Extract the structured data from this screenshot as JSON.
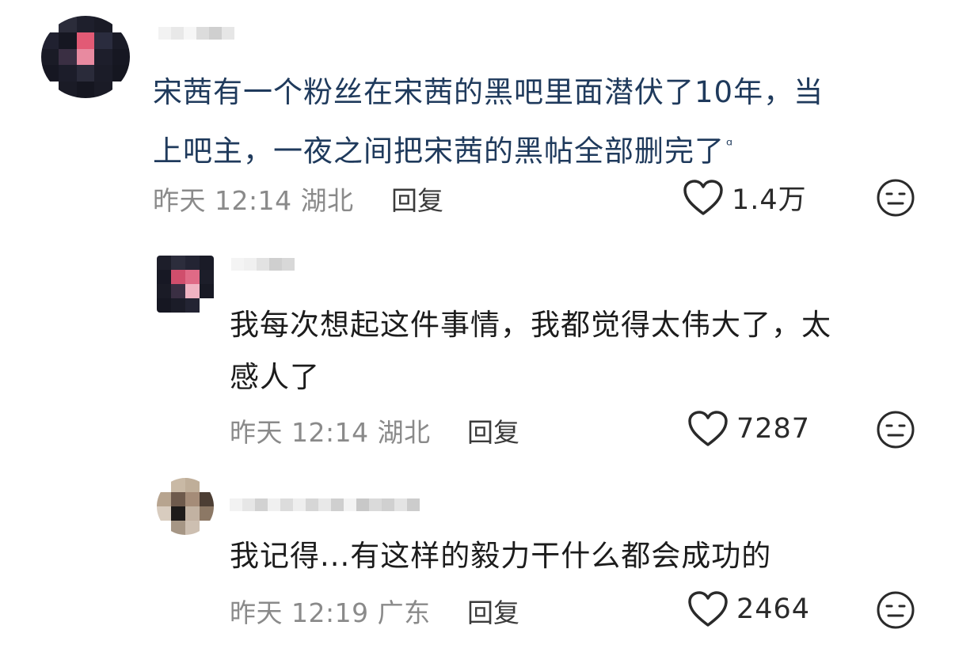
{
  "comments": [
    {
      "text_lines": [
        "宋茜有一个粉丝在宋茜的黑吧里面潜伏了10年，当",
        "上吧主，一夜之间把宋茜的黑帖全部删完了"
      ],
      "time": "昨天 12:14",
      "location": "湖北",
      "reply_label": "回复",
      "likes": "1.4万"
    },
    {
      "text_lines": [
        "我每次想起这件事情，我都觉得太伟大了，太",
        "感人了"
      ],
      "time": "昨天 12:14",
      "location": "湖北",
      "reply_label": "回复",
      "likes": "7287"
    },
    {
      "text_lines": [
        "我记得...有这样的毅力干什么都会成功的"
      ],
      "time": "昨天 12:19",
      "location": "广东",
      "reply_label": "回复",
      "likes": "2464"
    }
  ],
  "colors": {
    "main_text": "#1f3a5c",
    "reply_text": "#1c1c1c",
    "meta_text": "#8a8a8a",
    "icon_stroke": "#2a2a2a"
  },
  "icons": {
    "like": "heart-outline-icon",
    "dislike": "expressionless-face-icon",
    "translate": "translate-icon"
  }
}
